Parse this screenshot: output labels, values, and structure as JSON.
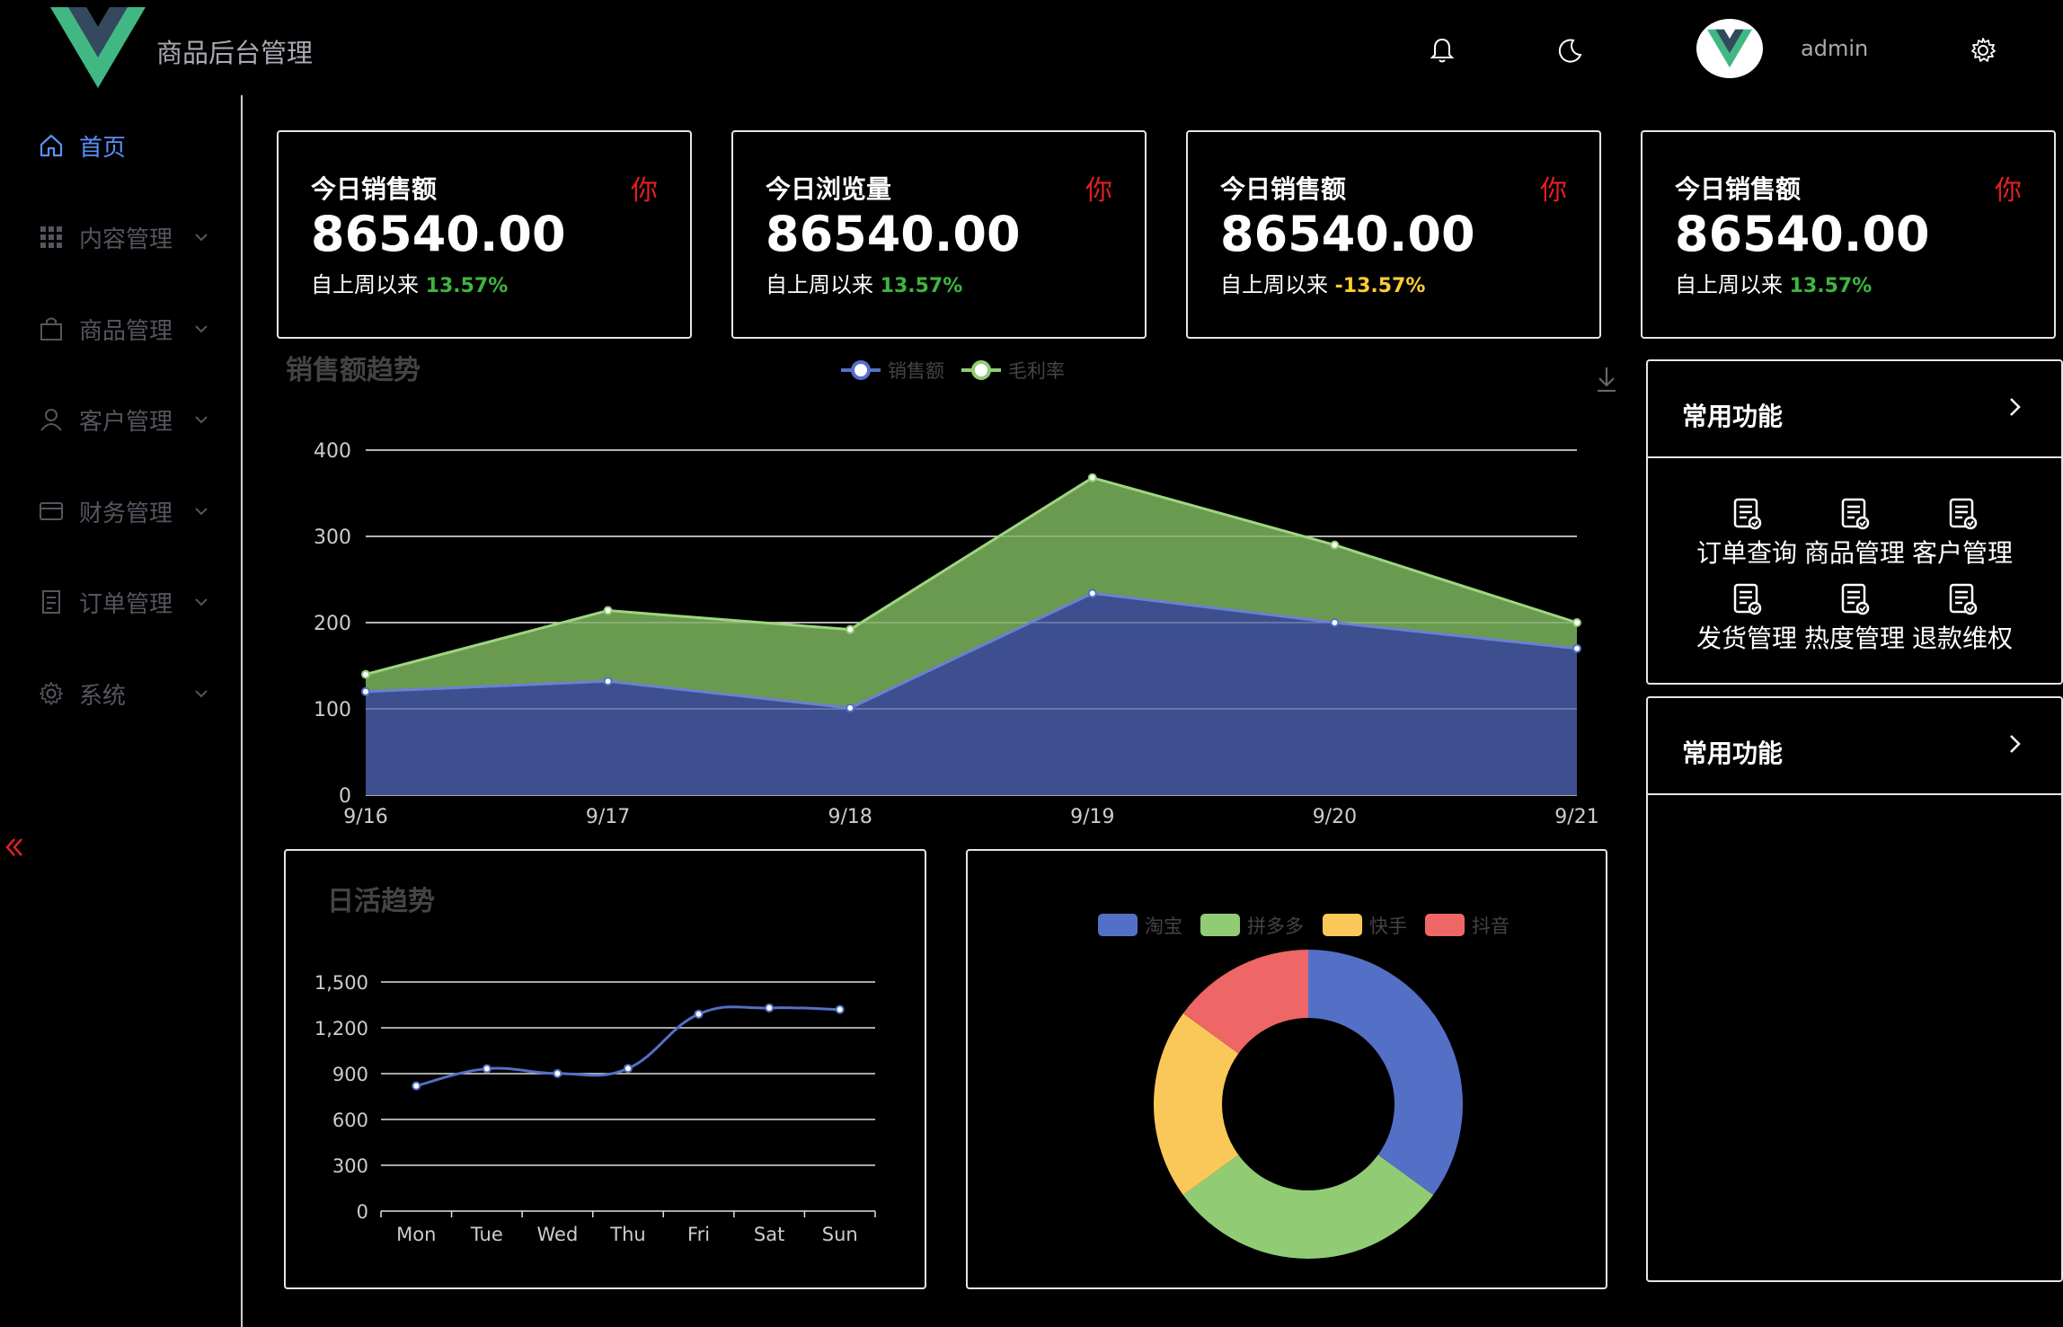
{
  "header": {
    "app_title": "商品后台管理",
    "username": "admin",
    "icons": [
      "bell-icon",
      "moon-icon",
      "gear-icon"
    ]
  },
  "colors": {
    "accent": "#5b8ff9",
    "sales": "#3d4f8f",
    "margin": "#6a9a4f",
    "positive": "#3fb63f",
    "negative": "#ffcc33",
    "badge": "#e02020"
  },
  "sidebar": {
    "items": [
      {
        "label": "首页",
        "icon": "home-icon",
        "active": true
      },
      {
        "label": "内容管理",
        "icon": "grid-icon",
        "active": false
      },
      {
        "label": "商品管理",
        "icon": "bag-icon",
        "active": false
      },
      {
        "label": "客户管理",
        "icon": "user-icon",
        "active": false
      },
      {
        "label": "财务管理",
        "icon": "card-icon",
        "active": false
      },
      {
        "label": "订单管理",
        "icon": "document-icon",
        "active": false
      },
      {
        "label": "系统",
        "icon": "settings-icon",
        "active": false
      }
    ]
  },
  "stats": [
    {
      "title": "今日销售额",
      "badge": "你",
      "value": "86540.00",
      "sub": "自上周以来",
      "pct": "13.57%",
      "negative": false
    },
    {
      "title": "今日浏览量",
      "badge": "你",
      "value": "86540.00",
      "sub": "自上周以来",
      "pct": "13.57%",
      "negative": false
    },
    {
      "title": "今日销售额",
      "badge": "你",
      "value": "86540.00",
      "sub": "自上周以来",
      "pct": "-13.57%",
      "negative": true
    },
    {
      "title": "今日销售额",
      "badge": "你",
      "value": "86540.00",
      "sub": "自上周以来",
      "pct": "13.57%",
      "negative": false
    }
  ],
  "functions": [
    {
      "title": "常用功能",
      "items": [
        "订单查询",
        "商品管理",
        "客户管理",
        "发货管理",
        "热度管理",
        "退款维权"
      ]
    },
    {
      "title": "常用功能",
      "items": []
    }
  ],
  "chart_data": [
    {
      "type": "area",
      "title": "销售额趋势",
      "categories": [
        "9/16",
        "9/17",
        "9/18",
        "9/19",
        "9/20",
        "9/21"
      ],
      "series": [
        {
          "name": "销售额",
          "values": [
            120,
            132,
            101,
            234,
            200,
            170
          ],
          "color": "#3d4f8f"
        },
        {
          "name": "毛利率",
          "values": [
            20,
            82,
            91,
            134,
            90,
            30
          ],
          "color": "#6a9a4f"
        }
      ],
      "stacked": true,
      "ylim": [
        0,
        400
      ],
      "yticks": [
        0,
        100,
        200,
        300,
        400
      ],
      "legend": "top-center",
      "grid": true
    },
    {
      "type": "line",
      "title": "日活趋势",
      "categories": [
        "Mon",
        "Tue",
        "Wed",
        "Thu",
        "Fri",
        "Sat",
        "Sun"
      ],
      "series": [
        {
          "values": [
            820,
            932,
            901,
            934,
            1290,
            1330,
            1320
          ],
          "color": "#5470c6"
        }
      ],
      "ylim": [
        0,
        1500
      ],
      "yticks": [
        "0",
        "300",
        "600",
        "900",
        "1,200",
        "1,500"
      ],
      "grid": true,
      "smooth": true
    },
    {
      "type": "pie",
      "donut": true,
      "legend": "top-center",
      "series": [
        {
          "name": "淘宝",
          "value": 35,
          "color": "#5470c6"
        },
        {
          "name": "拼多多",
          "value": 30,
          "color": "#91cc75"
        },
        {
          "name": "快手",
          "value": 20,
          "color": "#fac858"
        },
        {
          "name": "抖音",
          "value": 15,
          "color": "#ee6666"
        }
      ]
    }
  ]
}
